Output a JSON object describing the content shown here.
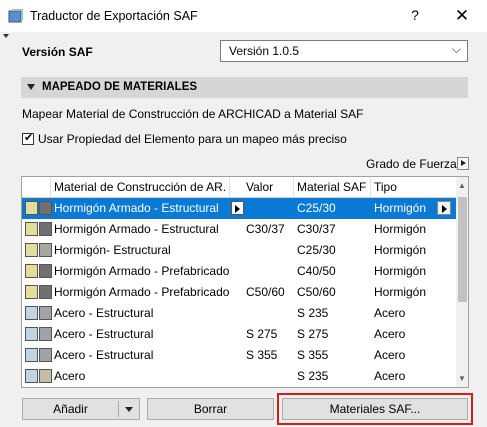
{
  "window": {
    "title": "Traductor de Exportación SAF",
    "help_label": "?",
    "close_label": "✕"
  },
  "version": {
    "label": "Versión SAF",
    "selected": "Versión 1.0.5"
  },
  "section": {
    "title": "MAPEADO DE MATERIALES"
  },
  "description": "Mapear Material de Construcción de ARCHICAD a Material SAF",
  "checkbox": {
    "label": "Usar Propiedad del Elemento para un mapeo más preciso",
    "checked": true
  },
  "grado_label": "Grado de Fuerza",
  "table": {
    "headers": [
      "Material de Construcción de AR...",
      "Valor",
      "Material SAF",
      "Tipo"
    ],
    "rows": [
      {
        "material": "Hormigón Armado - Estructural",
        "valor": "",
        "saf": "C25/30",
        "tipo": "Hormigón",
        "selected": true,
        "sw1": "#e4dc98",
        "sw2": "#707070"
      },
      {
        "material": "Hormigón Armado - Estructural",
        "valor": "C30/37",
        "saf": "C30/37",
        "tipo": "Hormigón",
        "selected": false,
        "sw1": "#e4dc98",
        "sw2": "#707070"
      },
      {
        "material": "Hormigón- Estructural",
        "valor": "",
        "saf": "C25/30",
        "tipo": "Hormigón",
        "selected": false,
        "sw1": "#e4dc98",
        "sw2": "#a8a8a0"
      },
      {
        "material": "Hormigón Armado - Prefabricado",
        "valor": "",
        "saf": "C40/50",
        "tipo": "Hormigón",
        "selected": false,
        "sw1": "#e4dc98",
        "sw2": "#707070"
      },
      {
        "material": "Hormigón Armado - Prefabricado",
        "valor": "C50/60",
        "saf": "C50/60",
        "tipo": "Hormigón",
        "selected": false,
        "sw1": "#e4dc98",
        "sw2": "#707070"
      },
      {
        "material": "Acero - Estructural",
        "valor": "",
        "saf": "S 235",
        "tipo": "Acero",
        "selected": false,
        "sw1": "#c0d4e8",
        "sw2": "#a0a4aa"
      },
      {
        "material": "Acero - Estructural",
        "valor": "S 275",
        "saf": "S 275",
        "tipo": "Acero",
        "selected": false,
        "sw1": "#c0d4e8",
        "sw2": "#a0a4aa"
      },
      {
        "material": "Acero - Estructural",
        "valor": "S 355",
        "saf": "S 355",
        "tipo": "Acero",
        "selected": false,
        "sw1": "#c0d4e8",
        "sw2": "#a0a4aa"
      },
      {
        "material": "Acero",
        "valor": "",
        "saf": "S 235",
        "tipo": "Acero",
        "selected": false,
        "sw1": "#c0d4e8",
        "sw2": "#c8bca8"
      }
    ]
  },
  "buttons": {
    "add": "Añadir",
    "delete": "Borrar",
    "saf_materials": "Materiales SAF..."
  },
  "colors": {
    "selection": "#0a7ad6",
    "highlight": "#e01818",
    "section_bg": "#d6d6d6"
  }
}
